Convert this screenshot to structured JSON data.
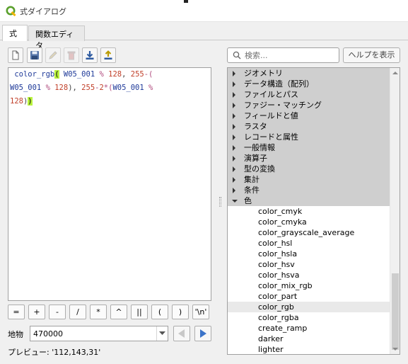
{
  "window": {
    "title": "式ダイアログ",
    "app_icon": "qgis-icon"
  },
  "tabs": [
    {
      "label": "式",
      "active": true
    },
    {
      "label": "関数エディタ",
      "active": false
    }
  ],
  "toolbar": {
    "buttons": [
      {
        "icon": "new-file-icon"
      },
      {
        "icon": "save-icon"
      },
      {
        "icon": "edit-icon"
      },
      {
        "icon": "delete-icon"
      },
      {
        "icon": "import-icon"
      },
      {
        "icon": "export-icon"
      }
    ]
  },
  "editor": {
    "lines": [
      [
        {
          "t": " ",
          "c": "plain"
        },
        {
          "t": "color_rgb",
          "c": "fn"
        },
        {
          "t": "(",
          "c": "hl"
        },
        {
          "t": " ",
          "c": "plain"
        },
        {
          "t": "W05_001",
          "c": "var"
        },
        {
          "t": " % ",
          "c": "op"
        },
        {
          "t": "128",
          "c": "num"
        },
        {
          "t": ", ",
          "c": "plain"
        },
        {
          "t": "255",
          "c": "num"
        },
        {
          "t": "-(",
          "c": "op"
        }
      ],
      [
        {
          "t": "W05_001",
          "c": "var"
        },
        {
          "t": " % ",
          "c": "op"
        },
        {
          "t": "128",
          "c": "num"
        },
        {
          "t": "), ",
          "c": "plain"
        },
        {
          "t": "255",
          "c": "num"
        },
        {
          "t": "-",
          "c": "op"
        },
        {
          "t": "2",
          "c": "num"
        },
        {
          "t": "*(",
          "c": "op"
        },
        {
          "t": "W05_001",
          "c": "var"
        },
        {
          "t": " %",
          "c": "op"
        }
      ],
      [
        {
          "t": "128",
          "c": "num"
        },
        {
          "t": ")",
          "c": "plain"
        },
        {
          "t": ")",
          "c": "hl"
        }
      ]
    ]
  },
  "operators": [
    "=",
    "+",
    "-",
    "/",
    "*",
    "^",
    "||",
    "(",
    ")",
    "'\\n'"
  ],
  "feature": {
    "label": "地物",
    "value": "470000"
  },
  "preview": {
    "text": "プレビュー: '112,143,31'"
  },
  "search": {
    "placeholder": "検索..."
  },
  "help_button": "ヘルプを表示",
  "tree": {
    "groups": [
      "ジオメトリ",
      "データ構造（配列）",
      "ファイルとパス",
      "ファジー・マッチング",
      "フィールドと値",
      "ラスタ",
      "レコードと属性",
      "一般情報",
      "演算子",
      "型の変換",
      "集計",
      "条件",
      "色"
    ],
    "expanded_group": "色",
    "items": [
      "color_cmyk",
      "color_cmyka",
      "color_grayscale_average",
      "color_hsl",
      "color_hsla",
      "color_hsv",
      "color_hsva",
      "color_mix_rgb",
      "color_part",
      "color_rgb",
      "color_rgba",
      "create_ramp",
      "darker",
      "lighter"
    ],
    "selected_item": "color_rgb"
  },
  "colors": {
    "highlight": "#b9f23e",
    "function": "#1f3a99",
    "number": "#c1402a",
    "group_bg": "#cfcfcf"
  }
}
